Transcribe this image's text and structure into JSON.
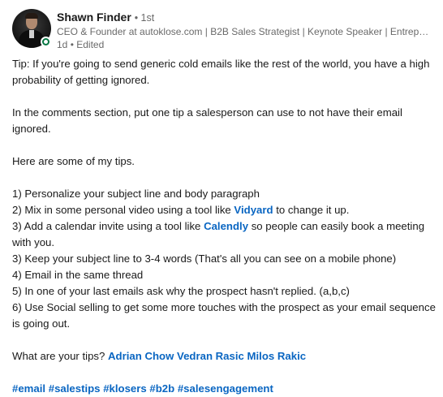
{
  "author": {
    "name": "Shawn Finder",
    "degree": "1st",
    "headline": "CEO & Founder at autoklose.com | B2B Sales Strategist | Keynote Speaker | Entrepreneur | Podcast Host",
    "time": "1d",
    "edited": "Edited",
    "status_color": "#057642"
  },
  "post": {
    "intro": "Tip: If you're going to send generic cold emails like the rest of the world, you have a high probability of getting ignored.",
    "ask": "In the comments section, put one tip a salesperson can use to not have their email ignored.",
    "tips_intro": "Here are some of my tips.",
    "tip1": "1) Personalize your subject line and body paragraph",
    "tip2_before": "2) Mix in some personal video using a tool like ",
    "tip2_link": "Vidyard",
    "tip2_after": " to change it up.",
    "tip3_before": "3) Add a calendar invite using a tool like ",
    "tip3_link": "Calendly",
    "tip3_after": " so people can easily book a meeting with you.",
    "tip4": "3) Keep your subject line to 3-4 words (That's all you can see on a mobile phone)",
    "tip5": "4) Email in the same thread",
    "tip6": "5) In one of your last emails ask why the prospect hasn't replied. (a,b,c)",
    "tip7": "6) Use Social selling to get some more touches with the prospect as your email sequence is going out.",
    "question": "What are your tips?",
    "mentions": [
      "Adrian Chow",
      "Vedran Rasic",
      "Milos Rakic"
    ],
    "hashtags": [
      "#email",
      "#salestips",
      "#klosers",
      "#b2b",
      "#salesengagement"
    ]
  },
  "colors": {
    "link": "#0a66c2",
    "text": "#191919",
    "secondary": "#666666"
  }
}
